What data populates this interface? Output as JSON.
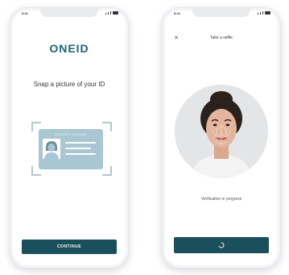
{
  "left_phone": {
    "status_time": "9:41",
    "logo": "ONEID",
    "title": "Snap a picture of your ID",
    "id_card": {
      "label": "DRIVER'S LICENSE"
    },
    "continue_label": "CONTINUE"
  },
  "right_phone": {
    "status_time": "9:41",
    "close_icon": "close-icon",
    "title": "Take a selfie",
    "status_text": "Verification in progress",
    "button_icon": "spinner-icon"
  },
  "colors": {
    "brand": "#1d6475",
    "button": "#1b4f5b",
    "card": "#a9c7d3"
  }
}
